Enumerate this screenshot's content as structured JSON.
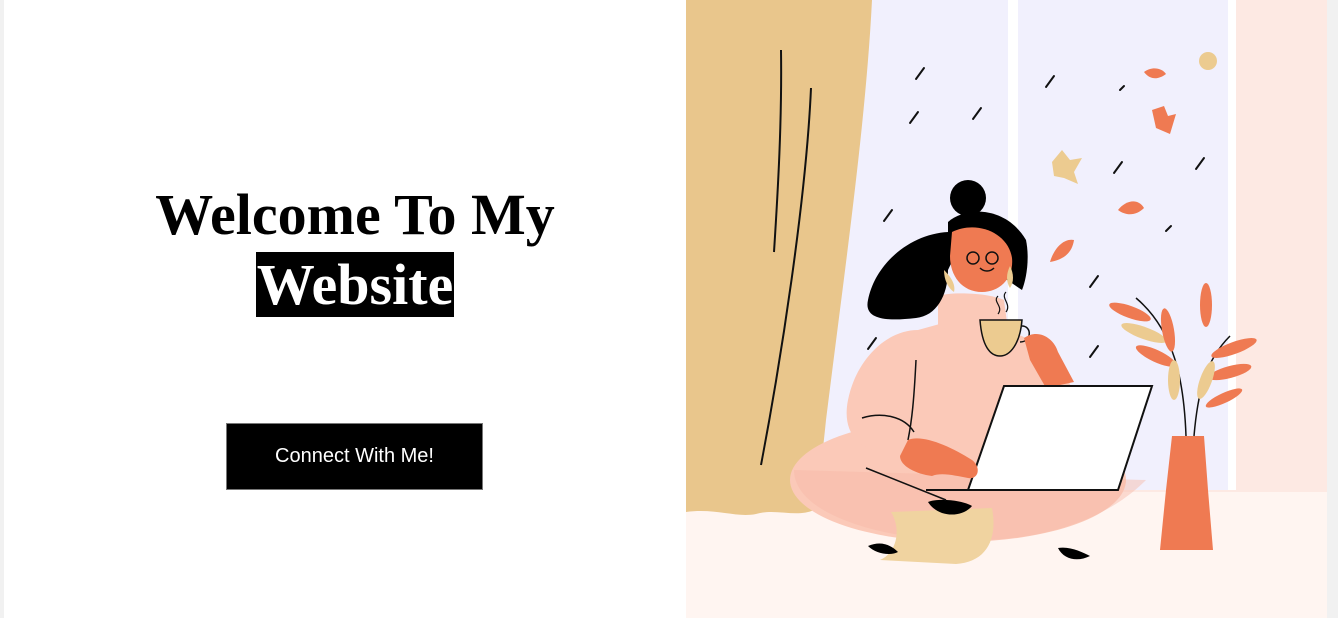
{
  "hero": {
    "title_line1": "Welcome To My",
    "title_highlight": "Website",
    "cta_label": "Connect With Me!"
  },
  "illustration": {
    "subject": "woman-with-laptop-and-tea-icon",
    "colors": {
      "curtain": "#e9c68c",
      "window": "#f1f0fd",
      "wall": "#fde9e3",
      "floor": "#fff5f1",
      "sweater": "#fbc9b8",
      "accent_orange": "#ef7a52",
      "skin": "#ef7a52",
      "hair": "#000000",
      "vase": "#ef7a52",
      "mug": "#eccb90"
    }
  }
}
